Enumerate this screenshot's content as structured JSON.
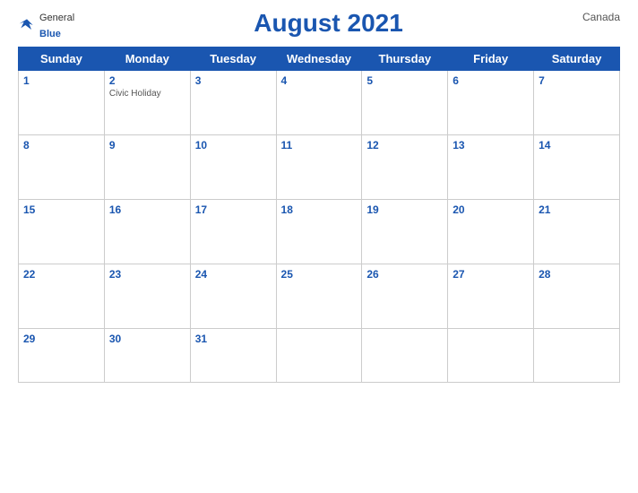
{
  "header": {
    "logo_general": "General",
    "logo_blue": "Blue",
    "title": "August 2021",
    "country": "Canada"
  },
  "weekdays": [
    "Sunday",
    "Monday",
    "Tuesday",
    "Wednesday",
    "Thursday",
    "Friday",
    "Saturday"
  ],
  "weeks": [
    [
      {
        "day": "1",
        "holiday": ""
      },
      {
        "day": "2",
        "holiday": "Civic Holiday"
      },
      {
        "day": "3",
        "holiday": ""
      },
      {
        "day": "4",
        "holiday": ""
      },
      {
        "day": "5",
        "holiday": ""
      },
      {
        "day": "6",
        "holiday": ""
      },
      {
        "day": "7",
        "holiday": ""
      }
    ],
    [
      {
        "day": "8",
        "holiday": ""
      },
      {
        "day": "9",
        "holiday": ""
      },
      {
        "day": "10",
        "holiday": ""
      },
      {
        "day": "11",
        "holiday": ""
      },
      {
        "day": "12",
        "holiday": ""
      },
      {
        "day": "13",
        "holiday": ""
      },
      {
        "day": "14",
        "holiday": ""
      }
    ],
    [
      {
        "day": "15",
        "holiday": ""
      },
      {
        "day": "16",
        "holiday": ""
      },
      {
        "day": "17",
        "holiday": ""
      },
      {
        "day": "18",
        "holiday": ""
      },
      {
        "day": "19",
        "holiday": ""
      },
      {
        "day": "20",
        "holiday": ""
      },
      {
        "day": "21",
        "holiday": ""
      }
    ],
    [
      {
        "day": "22",
        "holiday": ""
      },
      {
        "day": "23",
        "holiday": ""
      },
      {
        "day": "24",
        "holiday": ""
      },
      {
        "day": "25",
        "holiday": ""
      },
      {
        "day": "26",
        "holiday": ""
      },
      {
        "day": "27",
        "holiday": ""
      },
      {
        "day": "28",
        "holiday": ""
      }
    ],
    [
      {
        "day": "29",
        "holiday": ""
      },
      {
        "day": "30",
        "holiday": ""
      },
      {
        "day": "31",
        "holiday": ""
      },
      {
        "day": "",
        "holiday": ""
      },
      {
        "day": "",
        "holiday": ""
      },
      {
        "day": "",
        "holiday": ""
      },
      {
        "day": "",
        "holiday": ""
      }
    ]
  ],
  "colors": {
    "header_bg": "#1a56b0",
    "accent": "#1a56b0"
  }
}
